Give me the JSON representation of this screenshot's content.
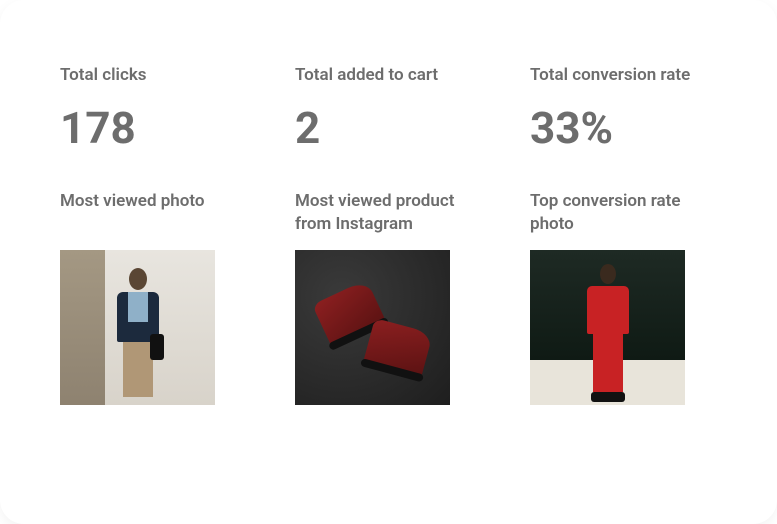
{
  "stats": [
    {
      "label": "Total clicks",
      "value": "178"
    },
    {
      "label": "Total added to cart",
      "value": "2"
    },
    {
      "label": "Total conversion rate",
      "value": "33%"
    }
  ],
  "photos": [
    {
      "label": "Most viewed photo",
      "alt": "Man in denim jacket standing on city street"
    },
    {
      "label": "Most viewed product from Instagram",
      "alt": "Pair of dark red leather boots on dark surface"
    },
    {
      "label": "Top conversion rate photo",
      "alt": "Man in red jacket and red trousers against dark green wall"
    }
  ]
}
